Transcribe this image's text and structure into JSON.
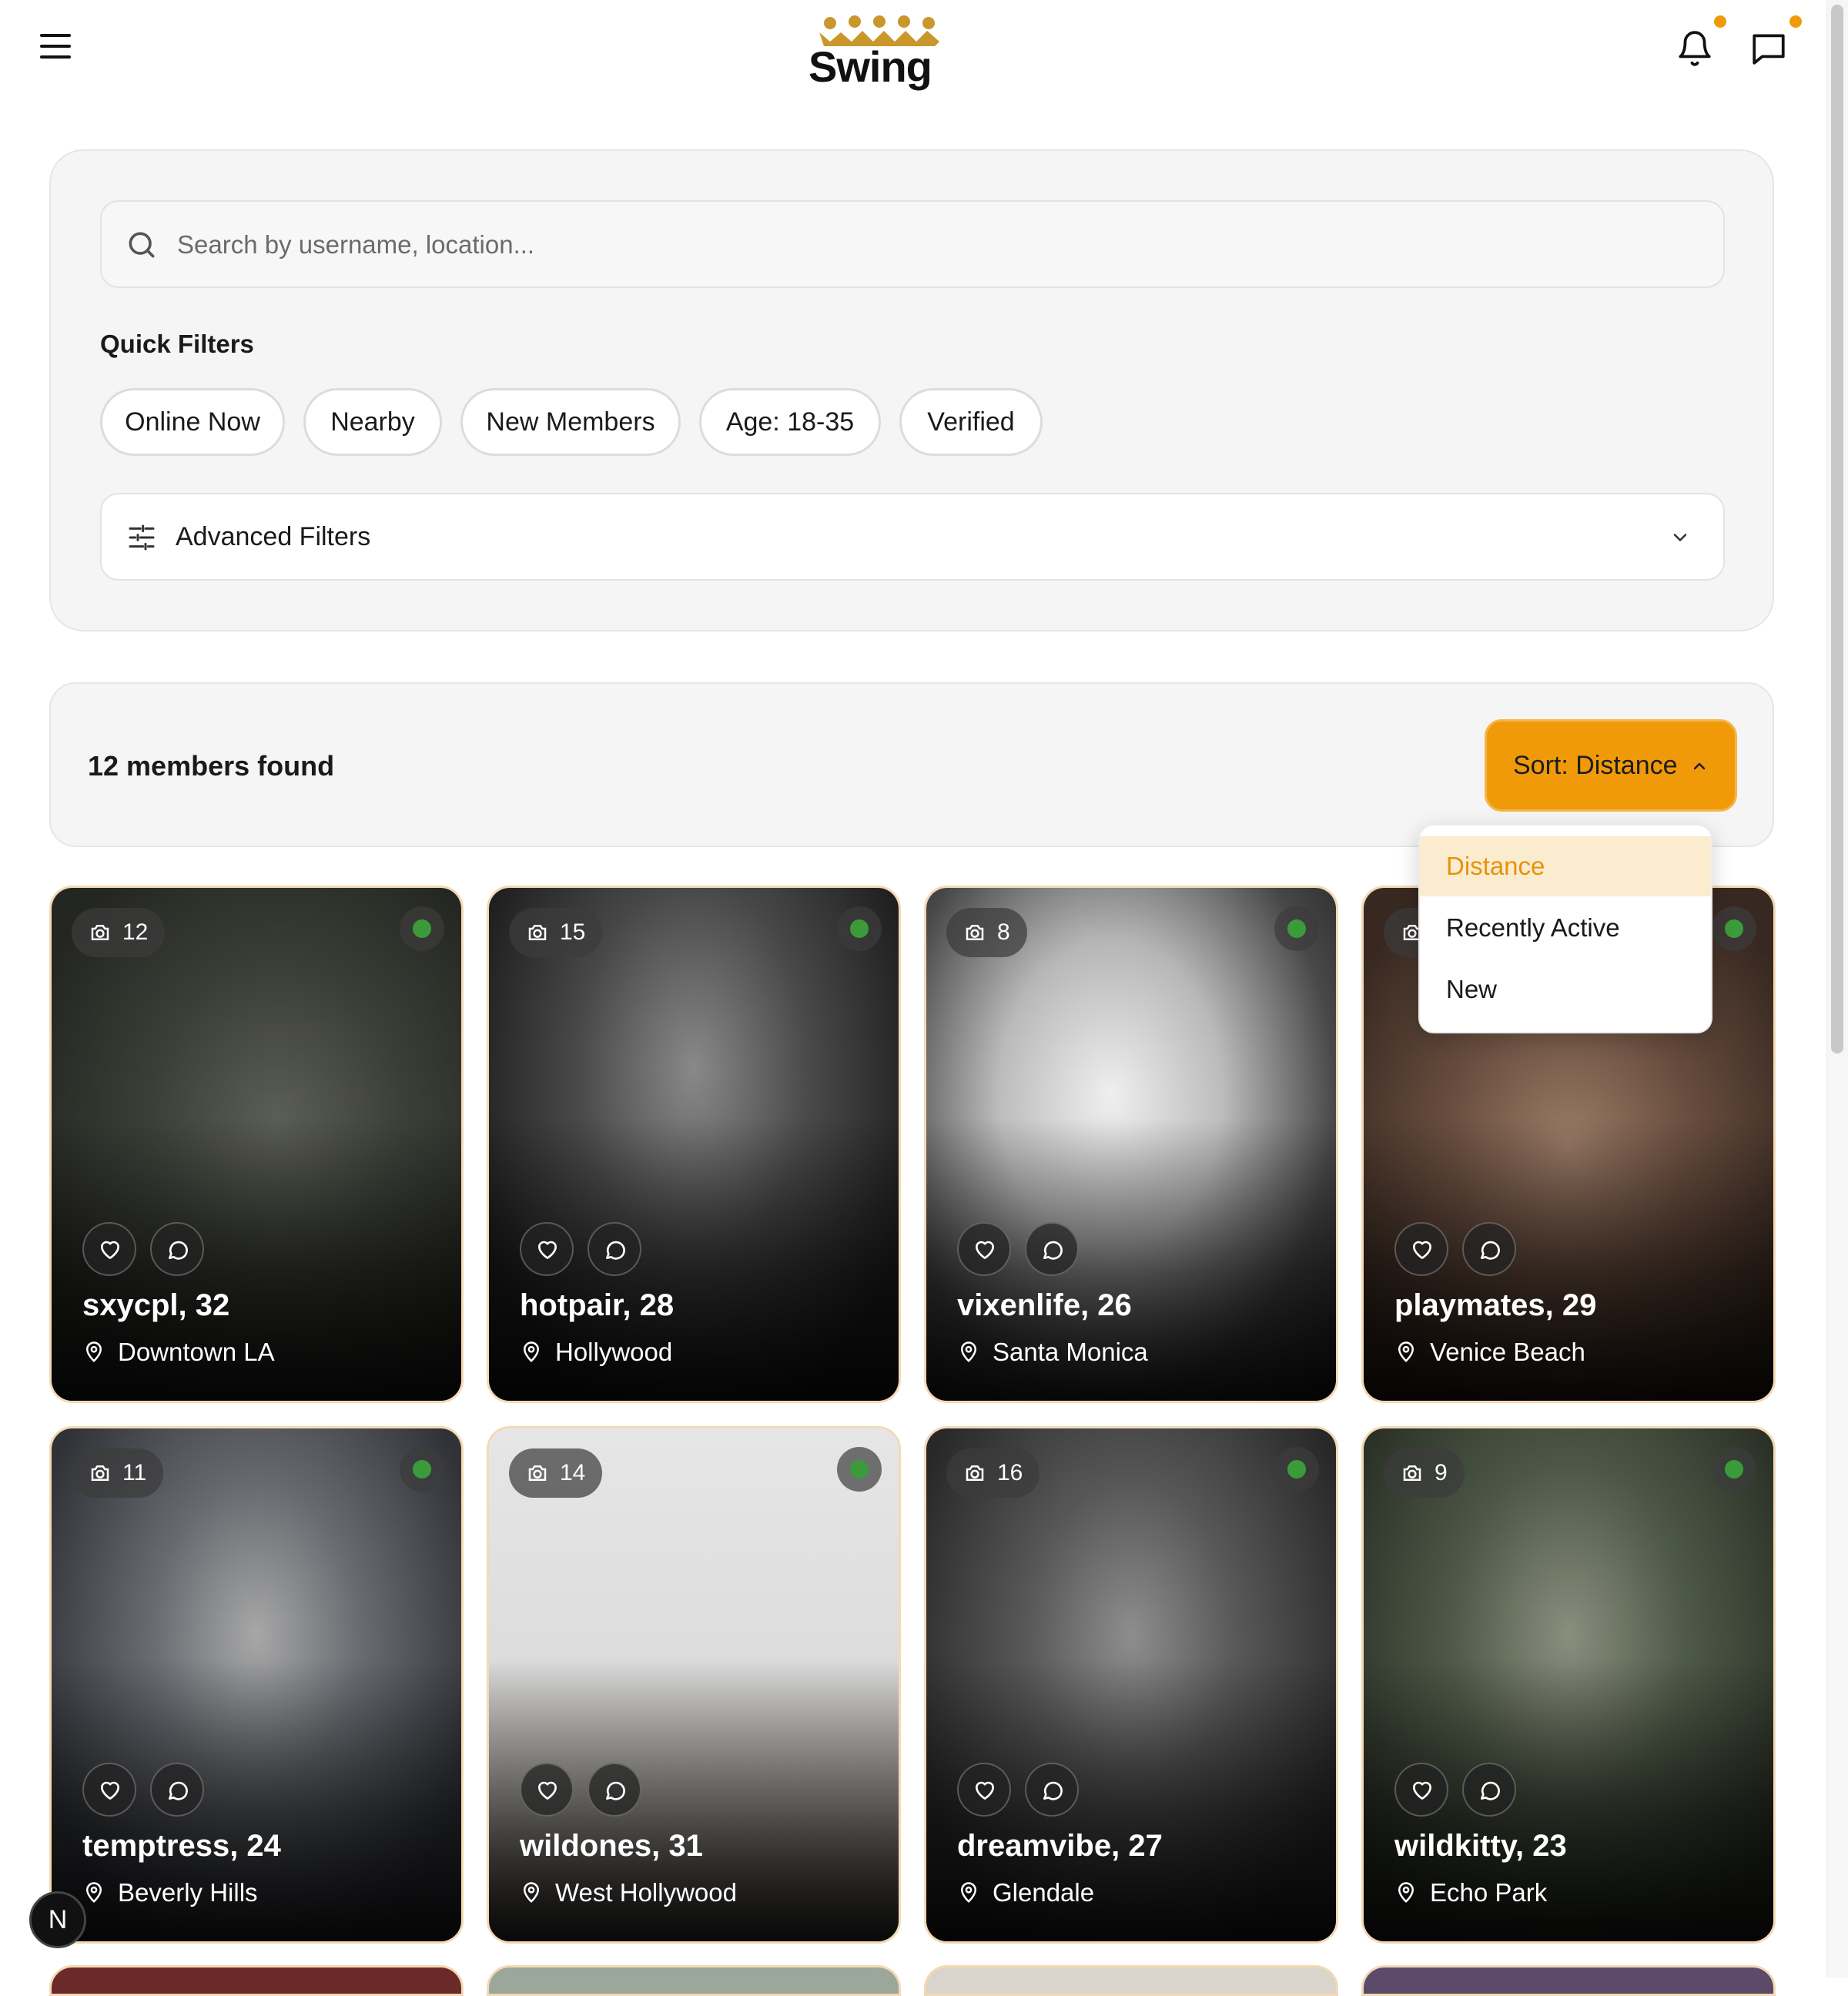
{
  "header": {
    "logo_text": "Swing",
    "accent_color": "#f09a0a",
    "icons": [
      "menu-icon",
      "bell-icon",
      "message-icon"
    ]
  },
  "search": {
    "placeholder": "Search by username, location...",
    "value": ""
  },
  "quick_filters": {
    "title": "Quick Filters",
    "chips": [
      "Online Now",
      "Nearby",
      "New Members",
      "Age: 18-35",
      "Verified"
    ]
  },
  "advanced_filters": {
    "label": "Advanced Filters"
  },
  "results": {
    "count_label": "12 members found",
    "sort_label": "Sort: Distance",
    "sort_options": [
      "Distance",
      "Recently Active",
      "New"
    ],
    "selected_option": "Distance"
  },
  "cards": [
    {
      "photos": "12",
      "name": "sxycpl, 32",
      "location": "Downtown LA",
      "online": true
    },
    {
      "photos": "15",
      "name": "hotpair, 28",
      "location": "Hollywood",
      "online": true
    },
    {
      "photos": "8",
      "name": "vixenlife, 26",
      "location": "Santa Monica",
      "online": true
    },
    {
      "photos": "",
      "name": "playmates, 29",
      "location": "Venice Beach",
      "online": true
    },
    {
      "photos": "11",
      "name": "temptress, 24",
      "location": "Beverly Hills",
      "online": true
    },
    {
      "photos": "14",
      "name": "wildones, 31",
      "location": "West Hollywood",
      "online": true
    },
    {
      "photos": "16",
      "name": "dreamvibe, 27",
      "location": "Glendale",
      "online": true
    },
    {
      "photos": "9",
      "name": "wildkitty, 23",
      "location": "Echo Park",
      "online": true
    }
  ],
  "dev_badge": "N"
}
